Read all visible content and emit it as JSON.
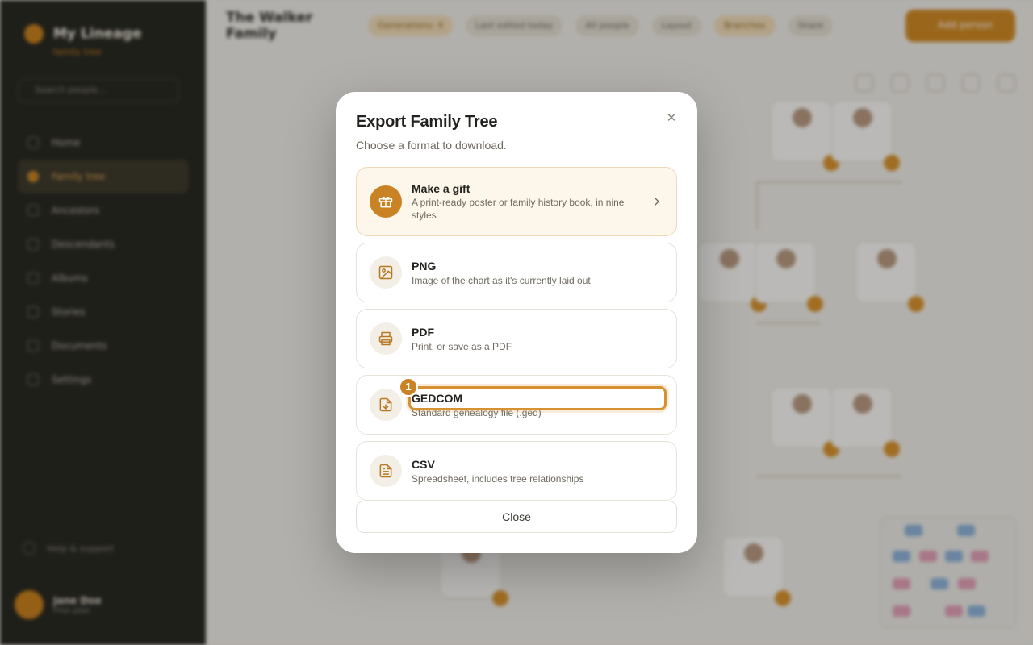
{
  "background": {
    "sidebar": {
      "logo_text": "My Lineage",
      "logo_sub": "family tree",
      "search_placeholder": "Search people…",
      "nav": [
        "Home",
        "Family tree",
        "Ancestors",
        "Descendants",
        "Albums",
        "Stories",
        "Documents",
        "Settings"
      ],
      "footer_link": "Help & support",
      "user_name": "Jane Doe",
      "user_sub": "Free plan"
    },
    "topbar": {
      "title": "The Walker Family",
      "chips": [
        "Generations: 4",
        "Last edited today",
        "All people",
        "Layout",
        "Branches",
        "Share"
      ],
      "add_button": "Add person"
    }
  },
  "modal": {
    "title": "Export Family Tree",
    "subtitle": "Choose a format to download.",
    "close_icon": "x-icon",
    "options": [
      {
        "label": "Make a gift",
        "description": "A print-ready poster or family history book, in nine styles",
        "icon": "gift-icon"
      },
      {
        "label": "PNG",
        "description": "Image of the chart as it's currently laid out",
        "icon": "image-icon"
      },
      {
        "label": "PDF",
        "description": "Print, or save as a PDF",
        "icon": "printer-icon"
      },
      {
        "label": "GEDCOM",
        "description": "Standard genealogy file (.ged)",
        "icon": "file-download-icon"
      },
      {
        "label": "CSV",
        "description": "Spreadsheet, includes tree relationships",
        "icon": "file-text-icon"
      }
    ],
    "highlight_badge": "1",
    "close_button": "Close"
  },
  "colors": {
    "accent": "#c98325",
    "gift_bg": "#fdf6ea",
    "sidebar_bg": "#2a2a24"
  }
}
